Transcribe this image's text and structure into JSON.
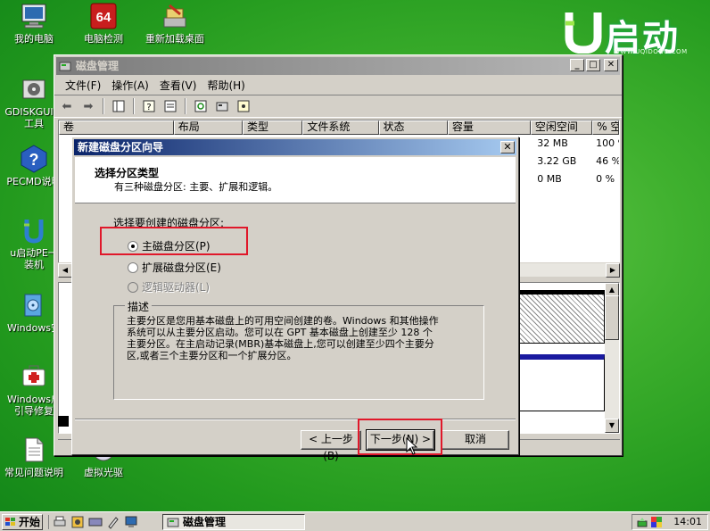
{
  "desktop": {
    "icons": [
      {
        "label": "我的电脑",
        "icon": "computer-icon"
      },
      {
        "label": "电脑检测",
        "icon": "64-icon"
      },
      {
        "label": "重新加载桌面",
        "icon": "reload-desktop-icon"
      },
      {
        "label": "GDISKGUI分\n工具",
        "icon": "diskgui-icon"
      },
      {
        "label": "PECMD说明",
        "icon": "help-icon"
      },
      {
        "label": "u启动PE一\n装机",
        "icon": "u-install-icon"
      },
      {
        "label": "Windows安",
        "icon": "windows-setup-icon"
      },
      {
        "label": "Windows启\n引导修复",
        "icon": "boot-repair-icon"
      },
      {
        "label": "常见问题说明",
        "icon": "document-icon"
      },
      {
        "label": "虚拟光驱",
        "icon": "virtual-drive-icon"
      }
    ],
    "logo_text": "启动",
    "logo_url": "WWW.UQIDONG.COM"
  },
  "window": {
    "title": "磁盘管理",
    "menu": [
      "文件(F)",
      "操作(A)",
      "查看(V)",
      "帮助(H)"
    ],
    "columns": [
      "卷",
      "布局",
      "类型",
      "文件系统",
      "状态",
      "容量",
      "空闲空间",
      "% 空"
    ],
    "rows": [
      {
        "free": "32 MB",
        "pct": "100 %"
      },
      {
        "free": "3.22 GB",
        "pct": "46 %"
      },
      {
        "free": "0 MB",
        "pct": "0 %"
      }
    ]
  },
  "dialog": {
    "title": "新建磁盘分区向导",
    "heading": "选择分区类型",
    "subheading": "有三种磁盘分区: 主要、扩展和逻辑。",
    "section_label": "选择要创建的磁盘分区:",
    "options": [
      {
        "label": "主磁盘分区(P)",
        "selected": true,
        "enabled": true
      },
      {
        "label": "扩展磁盘分区(E)",
        "selected": false,
        "enabled": true
      },
      {
        "label": "逻辑驱动器(L)",
        "selected": false,
        "enabled": false
      }
    ],
    "description_label": "描述",
    "description": "主要分区是您用基本磁盘上的可用空间创建的卷。Windows 和其他操作\n系统可以从主要分区启动。您可以在 GPT 基本磁盘上创建至少 128 个\n主要分区。在主启动记录(MBR)基本磁盘上,您可以创建至少四个主要分\n区,或者三个主要分区和一个扩展分区。",
    "back_button": "< 上一步(B)",
    "next_button": "下一步(N) >",
    "cancel_button": "取消"
  },
  "taskbar": {
    "start_label": "开始",
    "task_label": "磁盘管理",
    "clock": "14:01"
  },
  "colors": {
    "highlight_red": "#e0182a",
    "dialog_title_start": "#0a246a",
    "dialog_title_end": "#a6caf0"
  }
}
